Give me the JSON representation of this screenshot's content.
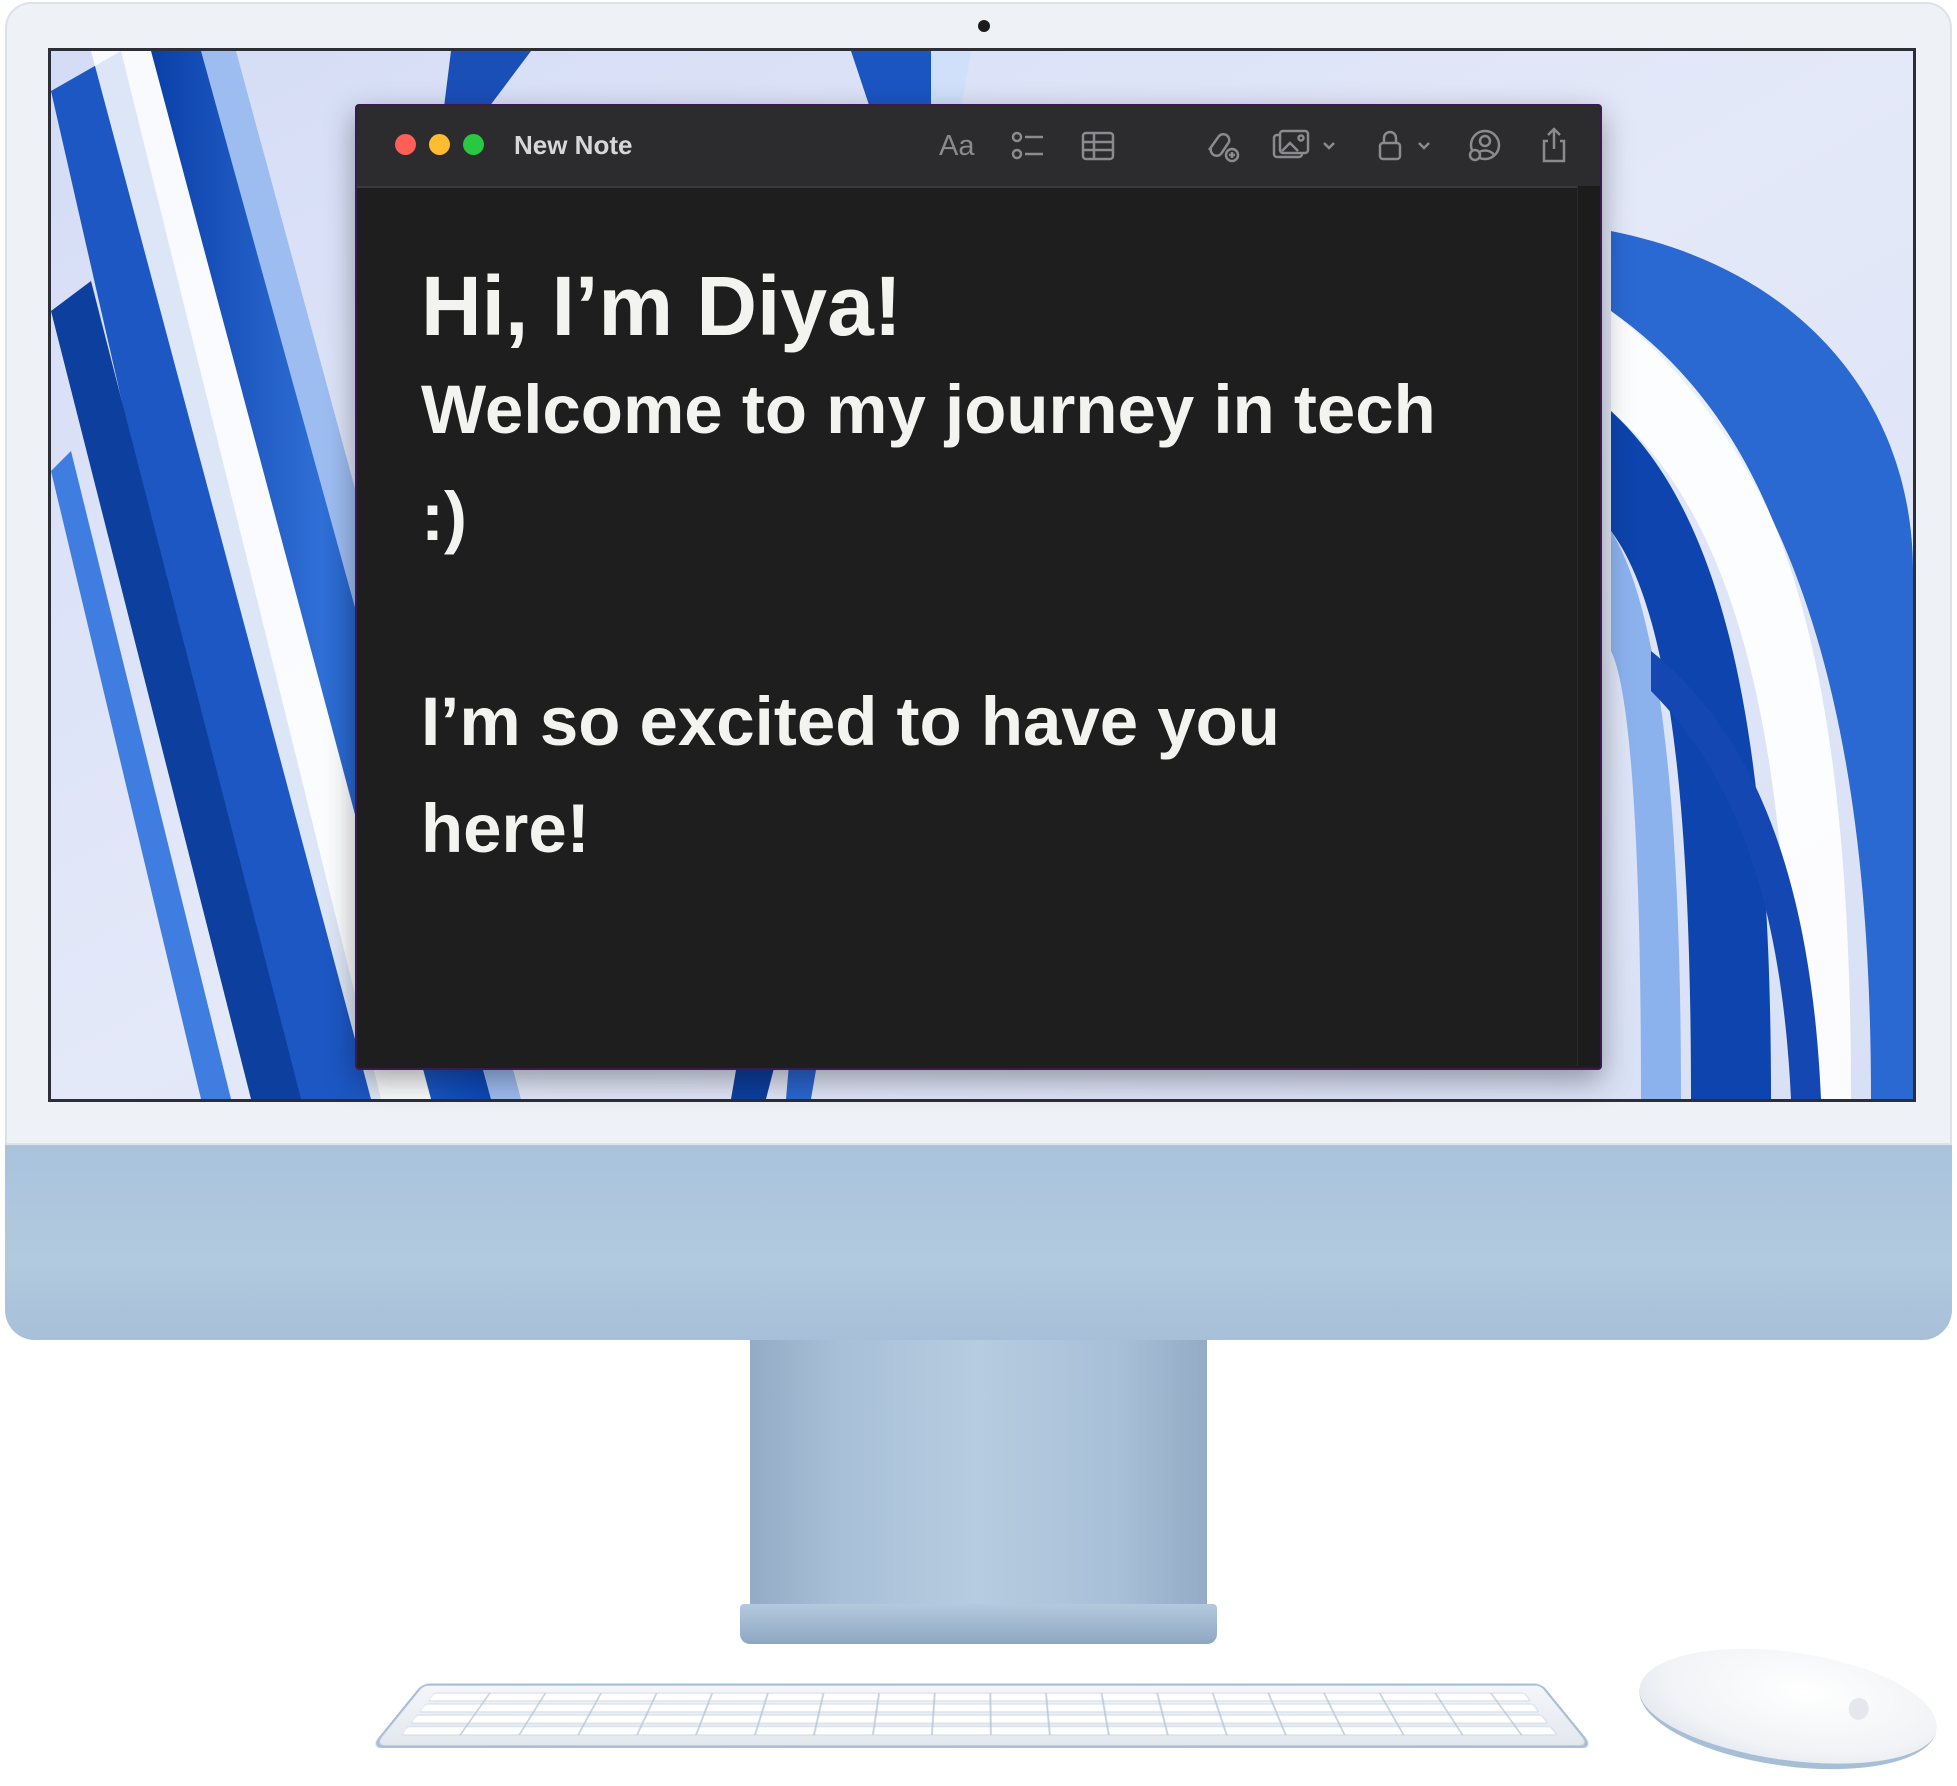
{
  "window": {
    "title": "New Note"
  },
  "toolbar": {
    "format_label": "Aa",
    "icons": [
      "format-text-icon",
      "checklist-icon",
      "table-icon",
      "collaborate-link-icon",
      "media-icon",
      "lock-icon",
      "share-collaborate-icon",
      "share-icon"
    ]
  },
  "note": {
    "heading": "Hi, I’m Diya!",
    "line1": "Welcome to my journey in tech",
    "line2": ":)",
    "line3": "I’m so excited to have you",
    "line4": "here!"
  },
  "colors": {
    "close": "#ff5f57",
    "minimize": "#febc2e",
    "maximize": "#28c840",
    "note_background": "#1e1e1e",
    "note_text": "#f3f3f0",
    "device_blue": "#a9c3dd"
  }
}
